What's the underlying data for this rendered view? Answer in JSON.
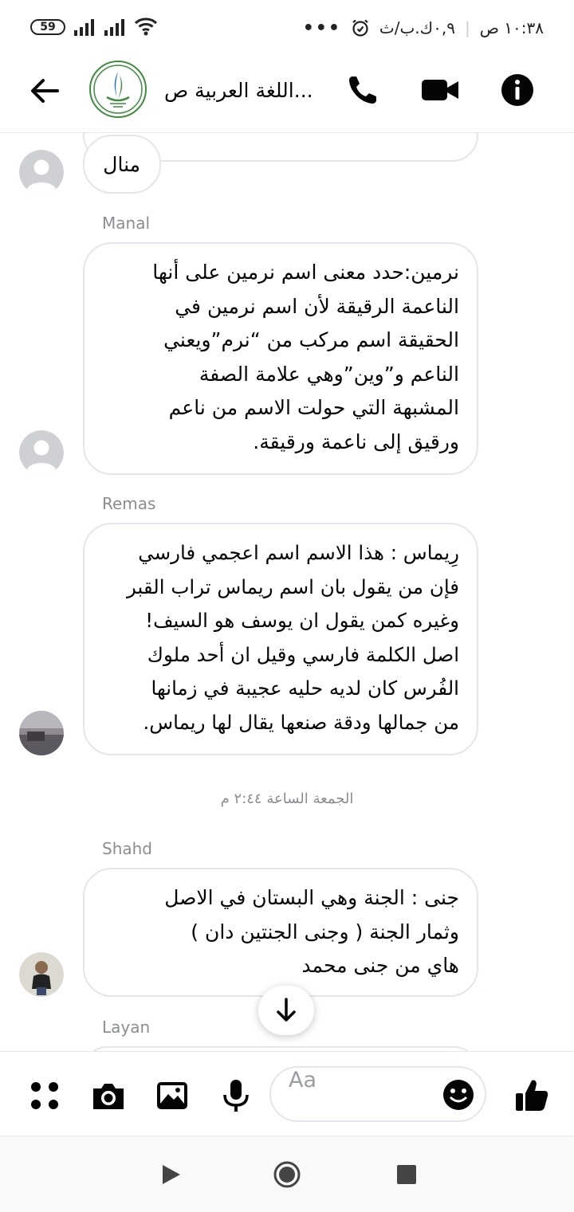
{
  "status_bar": {
    "battery": "59",
    "time": "١٠:٣٨ ص",
    "speed": "٠,٩ك.ب/ث",
    "more": "•••"
  },
  "header": {
    "title": "اللغة العربية ص...",
    "icons": [
      "back-arrow-icon",
      "group-logo",
      "phone-icon",
      "video-camera-icon",
      "info-icon"
    ]
  },
  "messages": [
    {
      "sender": "",
      "text": "منال"
    },
    {
      "sender": "Manal",
      "text": "نرمين:حدد معنى اسم نرمين على أنها\nالناعمة الرقيقة لأن اسم نرمين في\nالحقيقة اسم مركب من “نرم”ويعني\nالناعم و”وين”وهي علامة الصفة\nالمشبهة التي حولت الاسم من ناعم\nورقيق إلى ناعمة ورقيقة."
    },
    {
      "sender": "Remas",
      "text": "رِيماس : هذا الاسم اسم اعجمي فارسي\nفإن من يقول بان اسم ريماس تراب القبر\nوغيره كمن يقول ان يوسف هو السيف!\nاصل الكلمة فارسي وقيل ان أحد ملوك\nالفُرس كان لديه حليه عجيبة في زمانها\nمن جمالها ودقة صنعها يقال لها ريماس."
    },
    {
      "sender": "Shahd",
      "text": "جنى : الجنة وهي البستان في الاصل\nوثمار الجنة ( وجنى الجنتين دان )\nهاي من جنى محمد"
    },
    {
      "sender": "Layan",
      "text": ""
    }
  ],
  "timestamp": "الجمعة الساعة ٢:٤٤ م",
  "composer": {
    "placeholder": "Aa",
    "icons": [
      "grid-menu-icon",
      "camera-icon",
      "image-icon",
      "microphone-icon",
      "emoji-icon",
      "thumbs-up-icon"
    ]
  },
  "navbar": {
    "icons": [
      "back-triangle-icon",
      "home-circle-icon",
      "recents-square-icon"
    ]
  },
  "colors": {
    "accent": "#000000",
    "bubble_border": "#e4e6eb",
    "name_gray": "#8a8d91",
    "logo_green": "#3f8c3f"
  }
}
